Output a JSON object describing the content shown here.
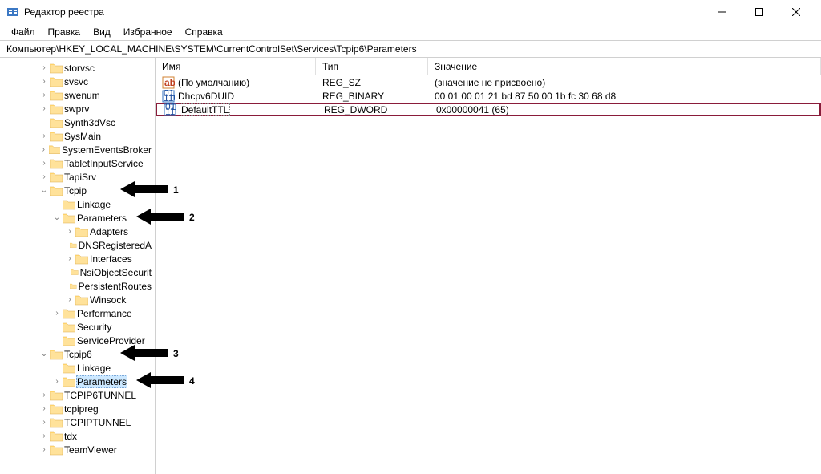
{
  "title": "Редактор реестра",
  "menu": [
    "Файл",
    "Правка",
    "Вид",
    "Избранное",
    "Справка"
  ],
  "address": "Компьютер\\HKEY_LOCAL_MACHINE\\SYSTEM\\CurrentControlSet\\Services\\Tcpip6\\Parameters",
  "tree": [
    {
      "lvl": 3,
      "tw": ">",
      "label": "storvsc"
    },
    {
      "lvl": 3,
      "tw": ">",
      "label": "svsvc"
    },
    {
      "lvl": 3,
      "tw": ">",
      "label": "swenum"
    },
    {
      "lvl": 3,
      "tw": ">",
      "label": "swprv"
    },
    {
      "lvl": 3,
      "tw": "",
      "label": "Synth3dVsc"
    },
    {
      "lvl": 3,
      "tw": ">",
      "label": "SysMain"
    },
    {
      "lvl": 3,
      "tw": ">",
      "label": "SystemEventsBroker"
    },
    {
      "lvl": 3,
      "tw": ">",
      "label": "TabletInputService"
    },
    {
      "lvl": 3,
      "tw": ">",
      "label": "TapiSrv"
    },
    {
      "lvl": 3,
      "tw": "v",
      "label": "Tcpip",
      "ann": 1
    },
    {
      "lvl": 4,
      "tw": "",
      "label": "Linkage"
    },
    {
      "lvl": 4,
      "tw": "v",
      "label": "Parameters",
      "ann": 2
    },
    {
      "lvl": 5,
      "tw": ">",
      "label": "Adapters"
    },
    {
      "lvl": 5,
      "tw": "",
      "label": "DNSRegisteredA"
    },
    {
      "lvl": 5,
      "tw": ">",
      "label": "Interfaces"
    },
    {
      "lvl": 5,
      "tw": "",
      "label": "NsiObjectSecurit"
    },
    {
      "lvl": 5,
      "tw": "",
      "label": "PersistentRoutes"
    },
    {
      "lvl": 5,
      "tw": ">",
      "label": "Winsock"
    },
    {
      "lvl": 4,
      "tw": ">",
      "label": "Performance"
    },
    {
      "lvl": 4,
      "tw": "",
      "label": "Security"
    },
    {
      "lvl": 4,
      "tw": "",
      "label": "ServiceProvider"
    },
    {
      "lvl": 3,
      "tw": "v",
      "label": "Tcpip6",
      "ann": 3
    },
    {
      "lvl": 4,
      "tw": "",
      "label": "Linkage"
    },
    {
      "lvl": 4,
      "tw": ">",
      "label": "Parameters",
      "selected": true,
      "ann": 4
    },
    {
      "lvl": 3,
      "tw": ">",
      "label": "TCPIP6TUNNEL"
    },
    {
      "lvl": 3,
      "tw": ">",
      "label": "tcpipreg"
    },
    {
      "lvl": 3,
      "tw": ">",
      "label": "TCPIPTUNNEL"
    },
    {
      "lvl": 3,
      "tw": ">",
      "label": "tdx"
    },
    {
      "lvl": 3,
      "tw": ">",
      "label": "TeamViewer"
    }
  ],
  "columns": {
    "name": "Имя",
    "type": "Тип",
    "value": "Значение"
  },
  "rows": [
    {
      "icon": "str",
      "name": "(По умолчанию)",
      "type": "REG_SZ",
      "value": "(значение не присвоено)"
    },
    {
      "icon": "bin",
      "name": "Dhcpv6DUID",
      "type": "REG_BINARY",
      "value": "00 01 00 01 21 bd 87 50 00 1b fc 30 68 d8"
    },
    {
      "icon": "bin",
      "name": "DefaultTTL",
      "type": "REG_DWORD",
      "value": "0x00000041 (65)",
      "hl": true,
      "dotted": true
    }
  ]
}
